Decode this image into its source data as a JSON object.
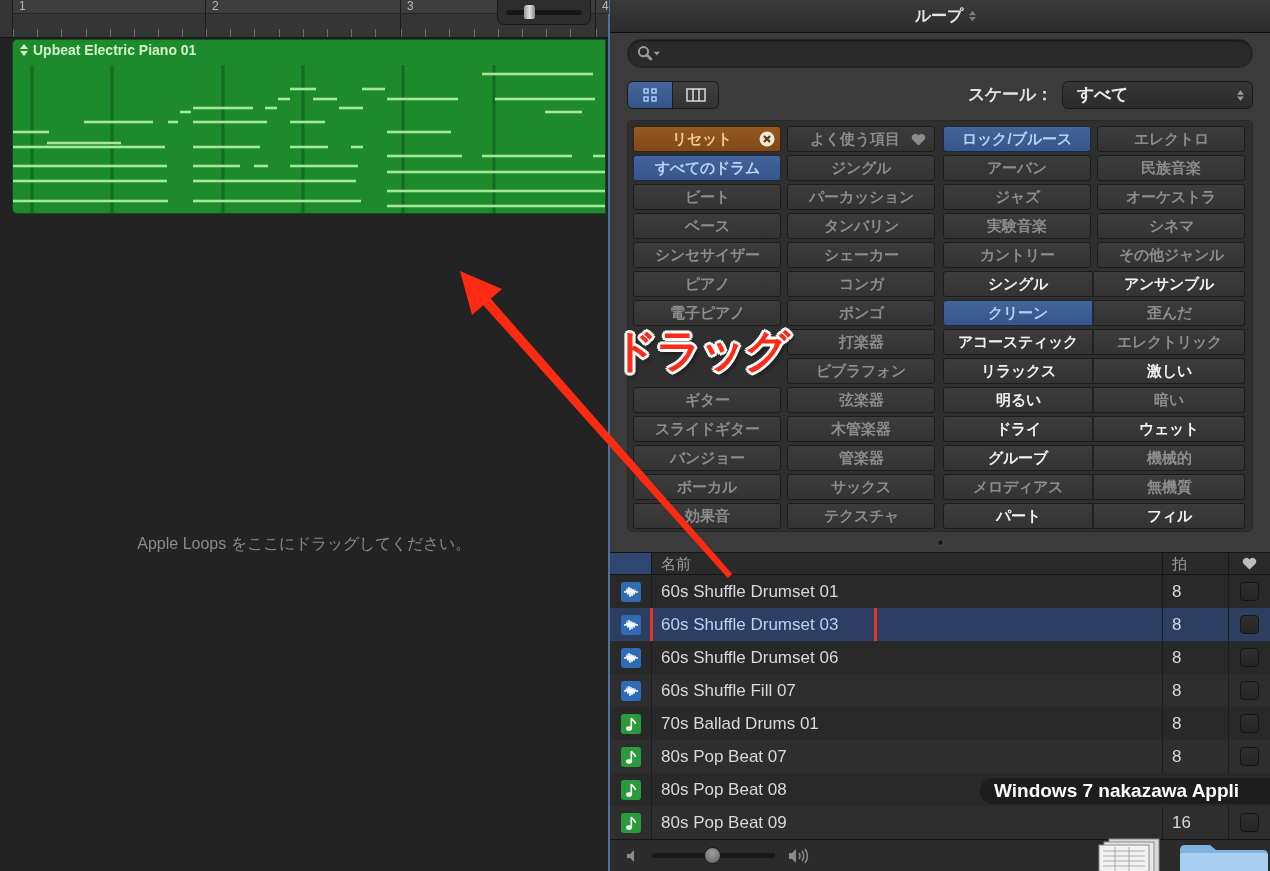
{
  "timeline": {
    "bar_numbers": [
      "1",
      "2",
      "3",
      "4"
    ],
    "zoom_slider": {
      "level": 0.3
    }
  },
  "region": {
    "title": "Upbeat Electric Piano 01"
  },
  "drop_hint": "Apple Loops をここにドラッグしてください。",
  "loop_browser": {
    "title": "ループ",
    "view_buttons": [
      {
        "kind": "grid",
        "selected": true
      },
      {
        "kind": "columns",
        "selected": false
      }
    ],
    "scale": {
      "label": "スケール：",
      "value": "すべて"
    },
    "keyword_rows": [
      [
        {
          "kind": "reset",
          "label": "リセット"
        },
        {
          "kind": "favorites",
          "label": "よく使う項目",
          "selected": false,
          "disabled": true
        },
        {
          "kind": "keyword",
          "label": "ロック/ブルース",
          "selected": true,
          "disabled": false
        },
        {
          "kind": "keyword",
          "label": "エレクトロ",
          "selected": false,
          "disabled": true
        }
      ],
      [
        {
          "kind": "keyword",
          "label": "すべてのドラム",
          "selected": true,
          "disabled": false
        },
        {
          "kind": "keyword",
          "label": "ジングル",
          "selected": false,
          "disabled": true
        },
        {
          "kind": "keyword",
          "label": "アーバン",
          "selected": false,
          "disabled": true
        },
        {
          "kind": "keyword",
          "label": "民族音楽",
          "selected": false,
          "disabled": true
        }
      ],
      [
        {
          "kind": "keyword",
          "label": "ビート",
          "selected": false,
          "disabled": true
        },
        {
          "kind": "keyword",
          "label": "パーカッション",
          "selected": false,
          "disabled": true
        },
        {
          "kind": "keyword",
          "label": "ジャズ",
          "selected": false,
          "disabled": true
        },
        {
          "kind": "keyword",
          "label": "オーケストラ",
          "selected": false,
          "disabled": true
        }
      ],
      [
        {
          "kind": "keyword",
          "label": "ベース",
          "selected": false,
          "disabled": true
        },
        {
          "kind": "keyword",
          "label": "タンバリン",
          "selected": false,
          "disabled": true
        },
        {
          "kind": "keyword",
          "label": "実験音楽",
          "selected": false,
          "disabled": true
        },
        {
          "kind": "keyword",
          "label": "シネマ",
          "selected": false,
          "disabled": true
        }
      ],
      [
        {
          "kind": "keyword",
          "label": "シンセサイザー",
          "selected": false,
          "disabled": true
        },
        {
          "kind": "keyword",
          "label": "シェーカー",
          "selected": false,
          "disabled": true
        },
        {
          "kind": "keyword",
          "label": "カントリー",
          "selected": false,
          "disabled": true
        },
        {
          "kind": "keyword",
          "label": "その他ジャンル",
          "selected": false,
          "disabled": true
        }
      ],
      [
        {
          "kind": "keyword",
          "label": "ピアノ",
          "selected": false,
          "disabled": true
        },
        {
          "kind": "keyword",
          "label": "コンガ",
          "selected": false,
          "disabled": true
        },
        {
          "kind": "descriptor",
          "label": "シングル",
          "selected": false,
          "disabled": false
        },
        {
          "kind": "descriptor",
          "label": "アンサンブル",
          "selected": false,
          "disabled": false
        }
      ],
      [
        {
          "kind": "keyword",
          "label": "電子ピアノ",
          "selected": false,
          "disabled": true
        },
        {
          "kind": "keyword",
          "label": "ボンゴ",
          "selected": false,
          "disabled": true
        },
        {
          "kind": "descriptor",
          "label": "クリーン",
          "selected": true,
          "disabled": false
        },
        {
          "kind": "descriptor",
          "label": "歪んだ",
          "selected": false,
          "disabled": true
        }
      ],
      [
        {
          "kind": "hidden"
        },
        {
          "kind": "keyword",
          "label": "打楽器",
          "selected": false,
          "disabled": true
        },
        {
          "kind": "descriptor",
          "label": "アコースティック",
          "selected": false,
          "disabled": false
        },
        {
          "kind": "descriptor",
          "label": "エレクトリック",
          "selected": false,
          "disabled": true
        }
      ],
      [
        {
          "kind": "hidden"
        },
        {
          "kind": "keyword",
          "label": "ビブラフォン",
          "selected": false,
          "disabled": true
        },
        {
          "kind": "descriptor",
          "label": "リラックス",
          "selected": false,
          "disabled": false
        },
        {
          "kind": "descriptor",
          "label": "激しい",
          "selected": false,
          "disabled": false
        }
      ],
      [
        {
          "kind": "keyword",
          "label": "ギター",
          "selected": false,
          "disabled": true
        },
        {
          "kind": "keyword",
          "label": "弦楽器",
          "selected": false,
          "disabled": true
        },
        {
          "kind": "descriptor",
          "label": "明るい",
          "selected": false,
          "disabled": false
        },
        {
          "kind": "descriptor",
          "label": "暗い",
          "selected": false,
          "disabled": true
        }
      ],
      [
        {
          "kind": "keyword",
          "label": "スライドギター",
          "selected": false,
          "disabled": true
        },
        {
          "kind": "keyword",
          "label": "木管楽器",
          "selected": false,
          "disabled": true
        },
        {
          "kind": "descriptor",
          "label": "ドライ",
          "selected": false,
          "disabled": false
        },
        {
          "kind": "descriptor",
          "label": "ウェット",
          "selected": false,
          "disabled": false
        }
      ],
      [
        {
          "kind": "keyword",
          "label": "バンジョー",
          "selected": false,
          "disabled": true
        },
        {
          "kind": "keyword",
          "label": "管楽器",
          "selected": false,
          "disabled": true
        },
        {
          "kind": "descriptor",
          "label": "グルーブ",
          "selected": false,
          "disabled": false
        },
        {
          "kind": "descriptor",
          "label": "機械的",
          "selected": false,
          "disabled": true
        }
      ],
      [
        {
          "kind": "keyword",
          "label": "ボーカル",
          "selected": false,
          "disabled": true
        },
        {
          "kind": "keyword",
          "label": "サックス",
          "selected": false,
          "disabled": true
        },
        {
          "kind": "descriptor",
          "label": "メロディアス",
          "selected": false,
          "disabled": true
        },
        {
          "kind": "descriptor",
          "label": "無機質",
          "selected": false,
          "disabled": true
        }
      ],
      [
        {
          "kind": "keyword",
          "label": "効果音",
          "selected": false,
          "disabled": true
        },
        {
          "kind": "keyword",
          "label": "テクスチャ",
          "selected": false,
          "disabled": true
        },
        {
          "kind": "descriptor",
          "label": "パート",
          "selected": false,
          "disabled": false
        },
        {
          "kind": "descriptor",
          "label": "フィル",
          "selected": false,
          "disabled": false
        }
      ]
    ],
    "results": {
      "columns": [
        {
          "label": "名前"
        },
        {
          "label": "拍"
        }
      ],
      "rows": [
        {
          "kind": "audio",
          "name": "60s Shuffle Drumset 01",
          "beats": "8",
          "selected": false,
          "highlighted": false,
          "favorite": false
        },
        {
          "kind": "audio",
          "name": "60s Shuffle Drumset 03",
          "beats": "8",
          "selected": true,
          "highlighted": true,
          "favorite": false
        },
        {
          "kind": "audio",
          "name": "60s Shuffle Drumset 06",
          "beats": "8",
          "selected": false,
          "highlighted": false,
          "favorite": false
        },
        {
          "kind": "audio",
          "name": "60s Shuffle Fill 07",
          "beats": "8",
          "selected": false,
          "highlighted": false,
          "favorite": false
        },
        {
          "kind": "midi",
          "name": "70s Ballad Drums 01",
          "beats": "8",
          "selected": false,
          "highlighted": false,
          "favorite": false
        },
        {
          "kind": "midi",
          "name": "80s Pop Beat 07",
          "beats": "8",
          "selected": false,
          "highlighted": false,
          "favorite": false
        },
        {
          "kind": "midi",
          "name": "80s Pop Beat 08",
          "selected": false,
          "highlighted": false
        },
        {
          "kind": "midi",
          "name": "80s Pop Beat 09",
          "beats": "16",
          "selected": false,
          "highlighted": false,
          "favorite": false
        }
      ]
    },
    "volume": {
      "level": 0.49
    }
  },
  "annotation": {
    "label": "ドラッグ"
  },
  "desktop": {
    "icon_label": "Windows 7 nakazawa Appli"
  }
}
